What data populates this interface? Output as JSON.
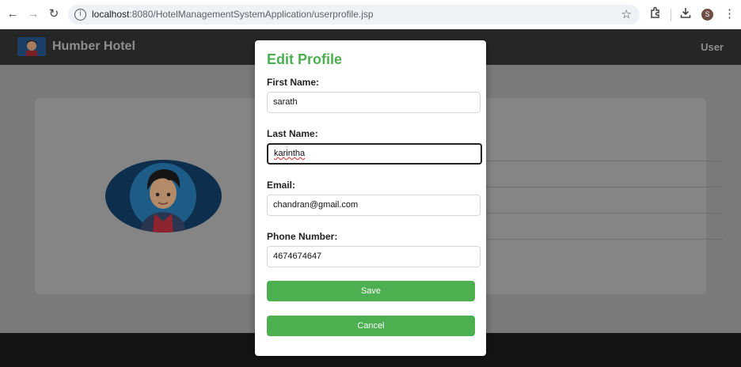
{
  "browser": {
    "url_host": "localhost",
    "url_path": ":8080/HotelManagementSystemApplication/userprofile.jsp",
    "profile_initial": "S"
  },
  "header": {
    "brand": "Humber Hotel",
    "user_link": "User"
  },
  "modal": {
    "title": "Edit Profile",
    "fields": [
      {
        "label": "First Name:",
        "value": "sarath"
      },
      {
        "label": "Last Name:",
        "value": "karintha"
      },
      {
        "label": "Email:",
        "value": "chandran@gmail.com"
      },
      {
        "label": "Phone Number:",
        "value": "4674674647"
      }
    ],
    "save_label": "Save",
    "cancel_label": "Cancel"
  },
  "colors": {
    "accent": "#4caf50",
    "header_bg": "#262626"
  }
}
